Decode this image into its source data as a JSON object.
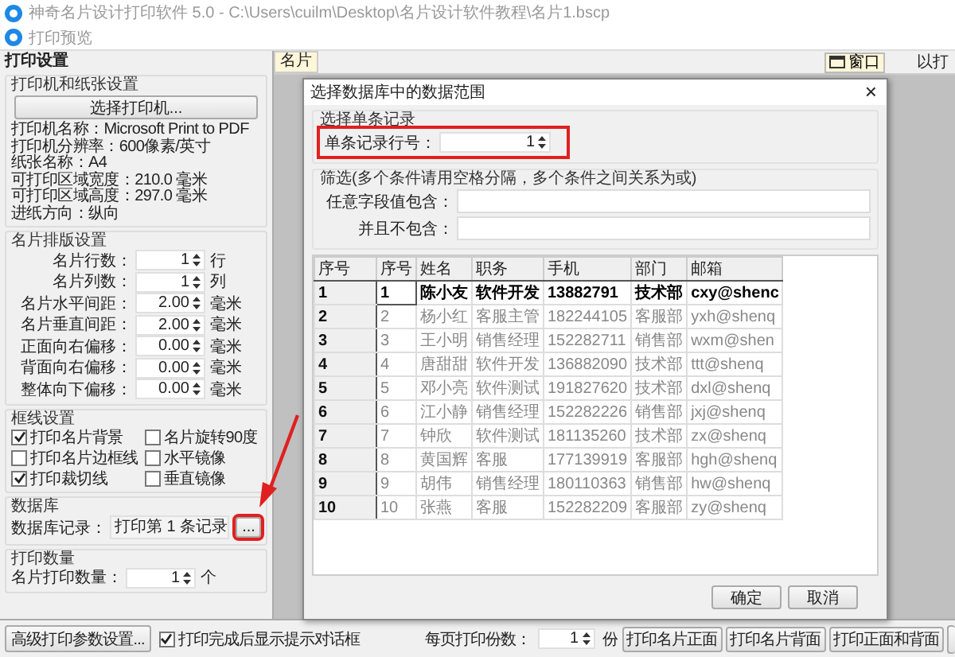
{
  "app_title": "神奇名片设计打印软件 5.0 - C:\\Users\\cuilm\\Desktop\\名片设计软件教程\\名片1.bscp",
  "window": {
    "title": "打印预览"
  },
  "settings": {
    "header": "打印设置",
    "printer_group": {
      "title": "打印机和纸张设置",
      "button": "选择打印机...",
      "info": [
        "打印机名称：Microsoft Print to PDF",
        "打印机分辨率：600像素/英寸",
        "纸张名称：A4",
        "可打印区域宽度：210.0 毫米",
        "可打印区域高度：297.0 毫米",
        "进纸方向：纵向"
      ]
    },
    "layout_group": {
      "title": "名片排版设置",
      "rows": [
        {
          "label": "名片行数：",
          "value": "1",
          "unit": "行"
        },
        {
          "label": "名片列数：",
          "value": "1",
          "unit": "列"
        },
        {
          "label": "名片水平间距：",
          "value": "2.00",
          "unit": "毫米"
        },
        {
          "label": "名片垂直间距：",
          "value": "2.00",
          "unit": "毫米"
        },
        {
          "label": "正面向右偏移：",
          "value": "0.00",
          "unit": "毫米"
        },
        {
          "label": "背面向右偏移：",
          "value": "0.00",
          "unit": "毫米"
        },
        {
          "label": "整体向下偏移：",
          "value": "0.00",
          "unit": "毫米"
        }
      ]
    },
    "frame_group": {
      "title": "框线设置",
      "options": [
        {
          "label": "打印名片背景",
          "checked": true
        },
        {
          "label": "名片旋转90度",
          "checked": false
        },
        {
          "label": "打印名片边框线",
          "checked": false
        },
        {
          "label": "水平镜像",
          "checked": false
        },
        {
          "label": "打印裁切线",
          "checked": true
        },
        {
          "label": "垂直镜像",
          "checked": false
        }
      ]
    },
    "database_group": {
      "title": "数据库",
      "label": "数据库记录：",
      "value": "打印第 1 条记录",
      "button": "...",
      "highlighted": true
    },
    "quantity_group": {
      "title": "打印数量",
      "label": "名片打印数量：",
      "value": "1",
      "unit": "个"
    }
  },
  "preview_toolbar": {
    "tab": "名片",
    "window_button": "窗口",
    "cut_label": "以打"
  },
  "dialog": {
    "title": "选择数据库中的数据范围",
    "close": "×",
    "single_group": {
      "title": "选择单条记录",
      "label": "单条记录行号：",
      "value": "1",
      "highlighted": true
    },
    "filter_group": {
      "title": "筛选(多个条件请用空格分隔，多个条件之间关系为或)",
      "fields": [
        {
          "label": "任意字段值包含："
        },
        {
          "label": "并且不包含："
        }
      ]
    },
    "table": {
      "columns": [
        "序号",
        "序号",
        "姓名",
        "职务",
        "手机",
        "部门",
        "邮箱"
      ],
      "rows": [
        {
          "selected": true,
          "cells": [
            "1",
            "1",
            "陈小友",
            "软件开发",
            "13882791",
            "技术部",
            "cxy@shenc"
          ]
        },
        {
          "selected": false,
          "cells": [
            "2",
            "2",
            "杨小红",
            "客服主管",
            "182244105",
            "客服部",
            "yxh@shenq"
          ]
        },
        {
          "selected": false,
          "cells": [
            "3",
            "3",
            "王小明",
            "销售经理",
            "152282711",
            "销售部",
            "wxm@shen"
          ]
        },
        {
          "selected": false,
          "cells": [
            "4",
            "4",
            "唐甜甜",
            "软件开发",
            "136882090",
            "技术部",
            "ttt@shenq"
          ]
        },
        {
          "selected": false,
          "cells": [
            "5",
            "5",
            "邓小亮",
            "软件测试",
            "191827620",
            "技术部",
            "dxl@shenq"
          ]
        },
        {
          "selected": false,
          "cells": [
            "6",
            "6",
            "江小静",
            "销售经理",
            "152282226",
            "销售部",
            "jxj@shenq"
          ]
        },
        {
          "selected": false,
          "cells": [
            "7",
            "7",
            "钟欣",
            "软件测试",
            "181135260",
            "技术部",
            "zx@shenq"
          ]
        },
        {
          "selected": false,
          "cells": [
            "8",
            "8",
            "黄国辉",
            "客服",
            "177139919",
            "客服部",
            "hgh@shenq"
          ]
        },
        {
          "selected": false,
          "cells": [
            "9",
            "9",
            "胡伟",
            "销售经理",
            "180110363",
            "销售部",
            "hw@shenq"
          ]
        },
        {
          "selected": false,
          "cells": [
            "10",
            "10",
            "张燕",
            "客服",
            "152282209",
            "客服部",
            "zy@shenq"
          ]
        }
      ]
    },
    "buttons": [
      "确定",
      "取消"
    ]
  },
  "bottom_bar": {
    "advanced_button": "高级打印参数设置...",
    "notify": {
      "label": "打印完成后显示提示对话框",
      "checked": true
    },
    "copies_label": "每页打印份数：",
    "copies_value": "1",
    "copies_unit": "份",
    "buttons": [
      "打印名片正面",
      "打印名片背面",
      "打印正面和背面"
    ]
  }
}
